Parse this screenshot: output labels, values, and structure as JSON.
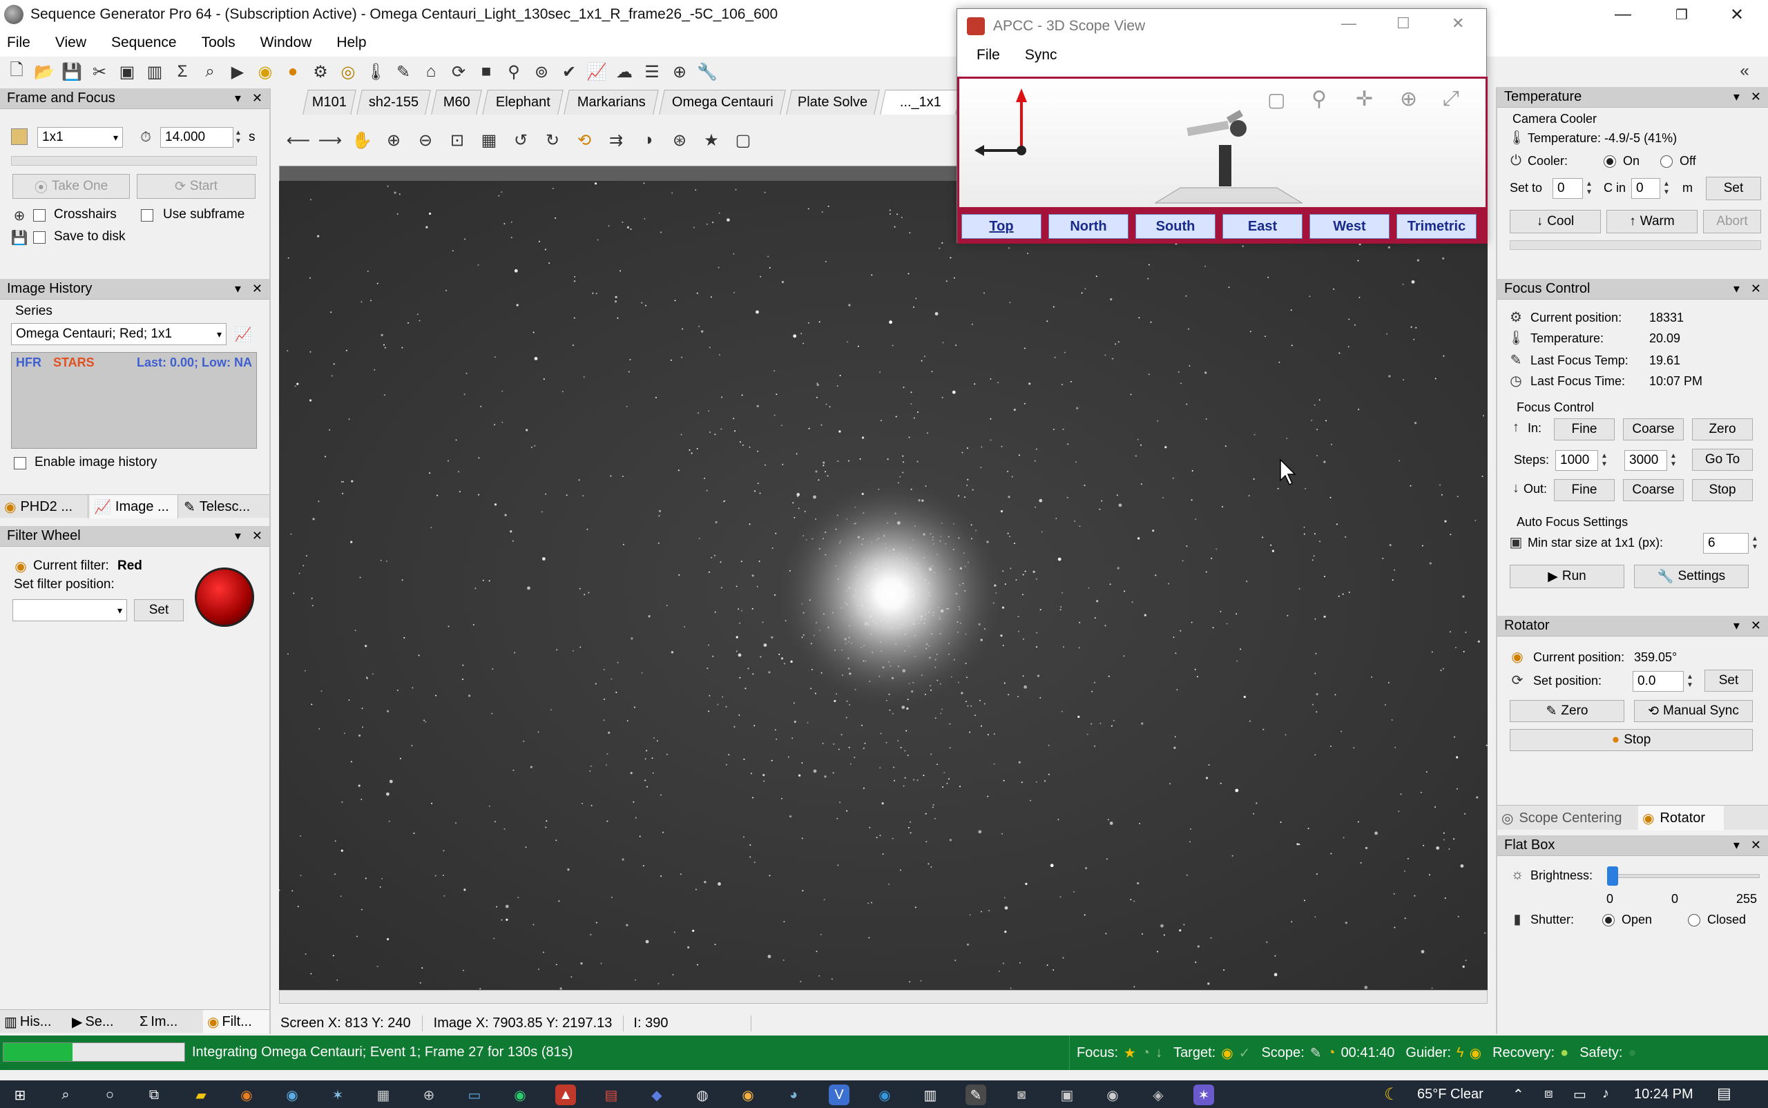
{
  "window": {
    "title": "Sequence Generator Pro 64 - (Subscription Active) - Omega Centauri_Light_130sec_1x1_R_frame26_-5C_106_600"
  },
  "menu": [
    "File",
    "View",
    "Sequence",
    "Tools",
    "Window",
    "Help"
  ],
  "frame_focus": {
    "title": "Frame and Focus",
    "binning": "1x1",
    "exposure": "14.000",
    "exposure_unit": "s",
    "take_one": "Take One",
    "start": "Start",
    "crosshairs": "Crosshairs",
    "use_subframe": "Use subframe",
    "save_to_disk": "Save to disk"
  },
  "image_history": {
    "title": "Image History",
    "series_label": "Series",
    "series_value": "Omega Centauri; Red; 1x1",
    "hfr": "HFR",
    "stars": "STARS",
    "last": "Last: 0.00; Low: NA",
    "enable": "Enable image history"
  },
  "left_tabs": [
    "PHD2 ...",
    "Image ...",
    "Telesc..."
  ],
  "filter_wheel": {
    "title": "Filter Wheel",
    "current_label": "Current filter:",
    "current_value": "Red",
    "set_label": "Set filter position:",
    "set_button": "Set"
  },
  "bottom_left_tabs": [
    "His...",
    "Se...",
    "Im...",
    "Filt..."
  ],
  "image_tabs": [
    "M101",
    "sh2-155",
    "M60",
    "Elephant",
    "Markarians",
    "Omega Centauri",
    "Plate Solve",
    "..._1x1"
  ],
  "status": {
    "screen": "Screen X: 813 Y: 240",
    "image": "Image X: 7903.85 Y: 2197.13",
    "intensity": "I: 390"
  },
  "progress": {
    "fraction": 0.38,
    "text": "Integrating Omega Centauri; Event 1; Frame 27 for 130s (81s)",
    "focus": "Focus:",
    "target": "Target:",
    "scope": "Scope:",
    "scope_time": "00:41:40",
    "guider": "Guider:",
    "recovery": "Recovery:",
    "safety": "Safety:"
  },
  "apcc": {
    "title": "APCC - 3D Scope View",
    "menu": [
      "File",
      "Sync"
    ],
    "views": [
      "Top",
      "North",
      "South",
      "East",
      "West",
      "Trimetric"
    ]
  },
  "temperature": {
    "title": "Temperature",
    "group": "Camera Cooler",
    "temp": "Temperature: -4.9/-5 (41%)",
    "cooler_label": "Cooler:",
    "on": "On",
    "off": "Off",
    "set_to": "Set to",
    "set_value": "0",
    "c_in": "C in",
    "in_value": "0",
    "m": "m",
    "set": "Set",
    "cool": "Cool",
    "warm": "Warm",
    "abort": "Abort"
  },
  "focus": {
    "title": "Focus Control",
    "current_label": "Current position:",
    "current_value": "18331",
    "temp_label": "Temperature:",
    "temp_value": "20.09",
    "last_temp_label": "Last Focus Temp:",
    "last_temp_value": "19.61",
    "last_time_label": "Last Focus Time:",
    "last_time_value": "10:07 PM",
    "group": "Focus Control",
    "in": "In:",
    "out": "Out:",
    "steps": "Steps:",
    "fine": "Fine",
    "coarse": "Coarse",
    "zero": "Zero",
    "goto": "Go To",
    "stop": "Stop",
    "fine_steps": "1000",
    "coarse_steps": "3000",
    "af_group": "Auto Focus Settings",
    "min_star": "Min star size at 1x1 (px):",
    "min_star_value": "6",
    "run": "Run",
    "settings": "Settings"
  },
  "rotator": {
    "title": "Rotator",
    "current_label": "Current position:",
    "current_value": "359.05°",
    "set_label": "Set position:",
    "set_value": "0.0",
    "set": "Set",
    "zero": "Zero",
    "manual_sync": "Manual Sync",
    "stop": "Stop"
  },
  "right_tabs": [
    "Scope Centering",
    "Rotator"
  ],
  "flatbox": {
    "title": "Flat Box",
    "brightness": "Brightness:",
    "brightness_level": 0,
    "min": "0",
    "value": "0",
    "max": "255",
    "shutter": "Shutter:",
    "open": "Open",
    "closed": "Closed"
  },
  "taskbar": {
    "weather": "65°F  Clear",
    "time": "10:24 PM"
  }
}
